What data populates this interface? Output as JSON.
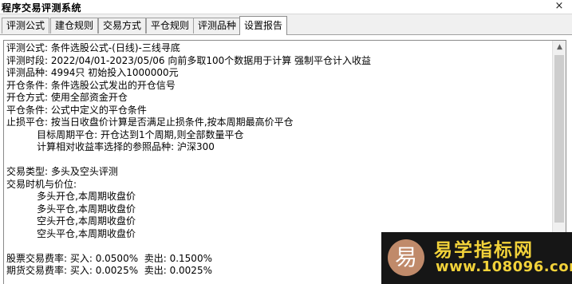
{
  "window": {
    "title": "程序交易评测系统",
    "close_glyph": "×"
  },
  "tabs": [
    {
      "label": "评测公式"
    },
    {
      "label": "建仓规则"
    },
    {
      "label": "交易方式"
    },
    {
      "label": "平仓规则"
    },
    {
      "label": "评测品种"
    },
    {
      "label": "设置报告"
    }
  ],
  "active_tab": "设置报告",
  "report": {
    "lines": [
      "评测公式: 条件选股公式-(日线)-三线寻底",
      "评测时段: 2022/04/01-2023/05/06 向前多取100个数据用于计算 强制平仓计入收益",
      "评测品种: 4994只 初始投入1000000元",
      "开仓条件: 条件选股公式发出的开仓信号",
      "开仓方式: 使用全部资金开仓",
      "平仓条件: 公式中定义的平仓条件",
      "止损平仓: 按当日收盘价计算是否满足止损条件,按本周期最高价平仓",
      "          目标周期平仓: 开仓达到1个周期,则全部数量平仓",
      "          计算相对收益率选择的参照品种: 沪深300",
      "",
      "交易类型: 多头及空头评测",
      "交易时机与价位:",
      "          多头开仓,本周期收盘价",
      "          多头平仓,本周期收盘价",
      "          空头开仓,本周期收盘价",
      "          空头平仓,本周期收盘价",
      "",
      "股票交易费率: 买入: 0.0500%  卖出: 0.1500%",
      "期货交易费率: 买入: 0.0025%  卖出: 0.0025%"
    ]
  },
  "watermark": {
    "logo_char": "易",
    "name": "易学指标网",
    "url": "www.108096.com"
  },
  "colors": {
    "watermark_bg": "#161616",
    "watermark_text": "#f2d23a",
    "logo_bg": "#c08a6a"
  }
}
